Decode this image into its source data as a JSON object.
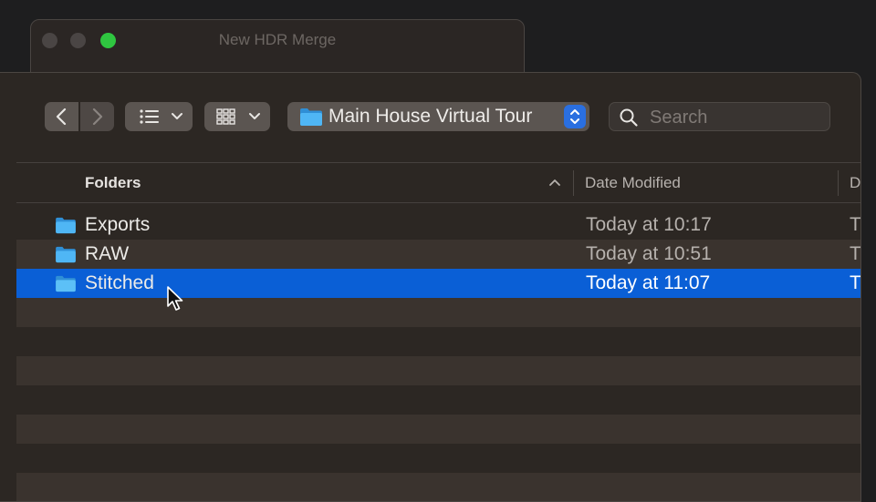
{
  "background_window": {
    "title": "New HDR Merge"
  },
  "toolbar": {
    "back_icon": "chevron-left-icon",
    "forward_icon": "chevron-right-icon",
    "list_view_icon": "list-icon",
    "grid_view_icon": "grid-icon",
    "location": "Main House Virtual Tour",
    "search_placeholder": "Search"
  },
  "columns": {
    "name": "Folders",
    "date_modified": "Date Modified",
    "next_truncated": "D"
  },
  "rows": [
    {
      "name": "Exports",
      "date": "Today at 10:17",
      "next": "T",
      "selected": false
    },
    {
      "name": "RAW",
      "date": "Today at 10:51",
      "next": "T",
      "selected": false
    },
    {
      "name": "Stitched",
      "date": "Today at 11:07",
      "next": "T",
      "selected": true
    }
  ],
  "colors": {
    "selection": "#0a5fd6",
    "folder": "#4fb6f5",
    "close_green": "#2fc640",
    "stepper": "#2a6fe0"
  }
}
